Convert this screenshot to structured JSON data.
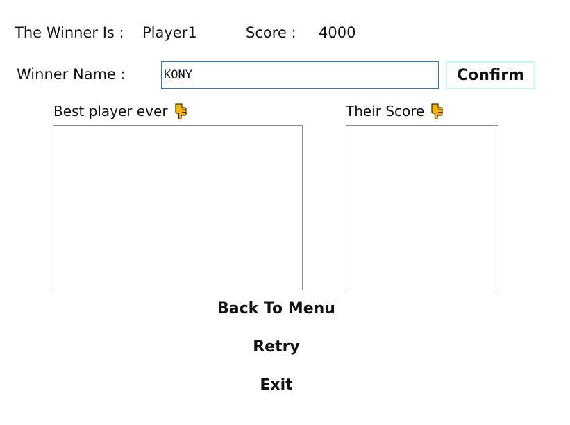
{
  "result": {
    "winner_label": "The Winner Is :",
    "winner_value": "Player1",
    "score_label": "Score :",
    "score_value": "4000"
  },
  "name_entry": {
    "label": "Winner Name :",
    "value": "KONY",
    "confirm_label": "Confirm"
  },
  "lists": {
    "best_player_label": "Best player ever",
    "their_score_label": "Their Score",
    "pointer_icon": "pointing-down-hand-icon",
    "icon_color": "#f5b400"
  },
  "menu": {
    "back_label": "Back To Menu",
    "retry_label": "Retry",
    "exit_label": "Exit"
  }
}
